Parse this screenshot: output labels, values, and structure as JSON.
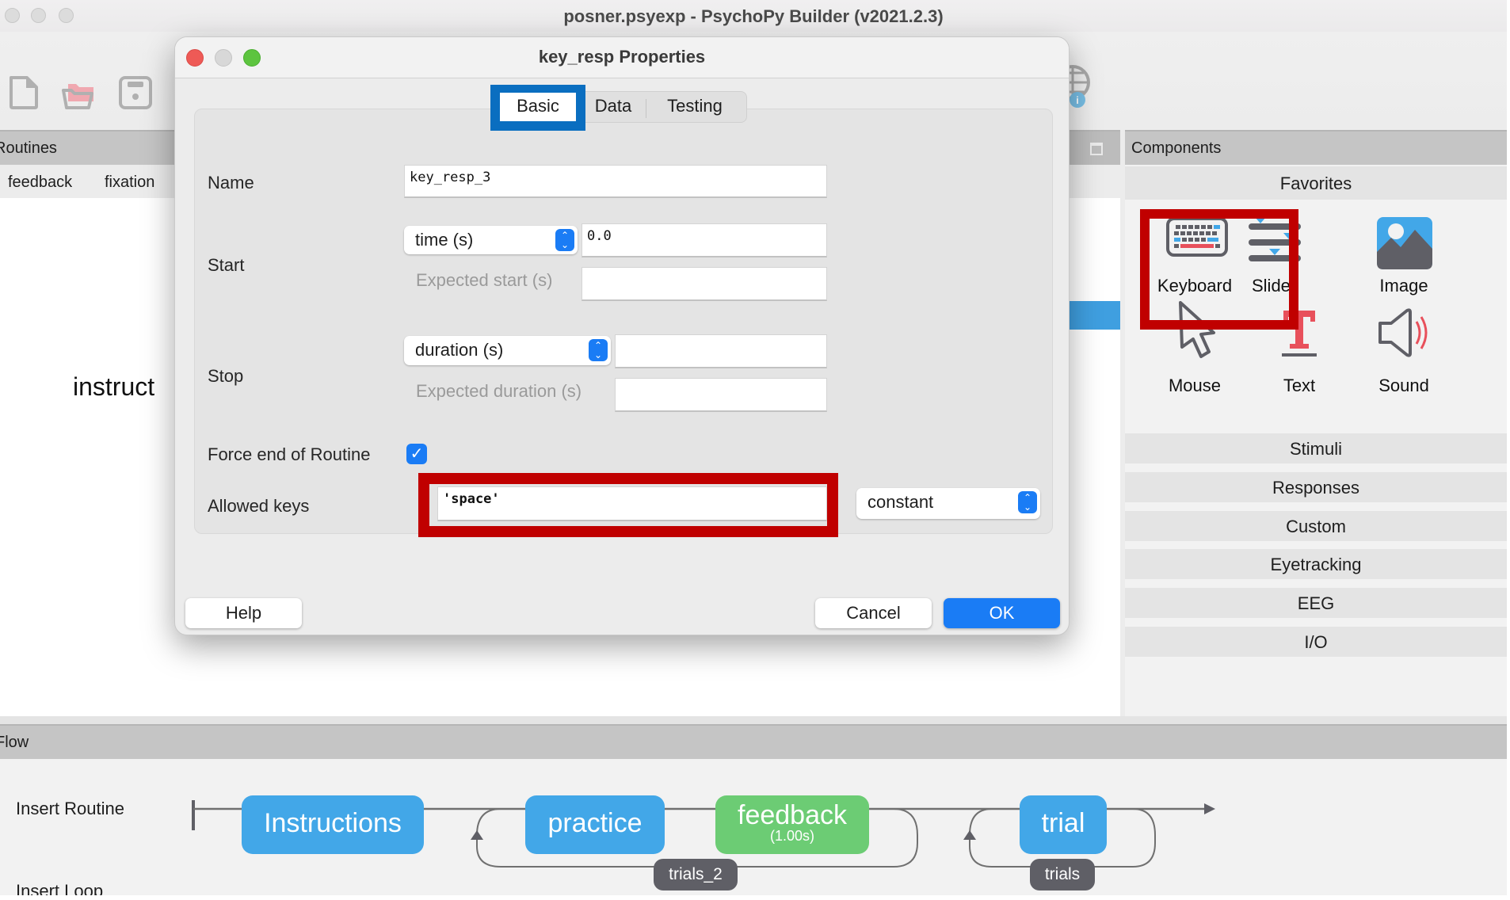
{
  "window": {
    "title": "posner.psyexp - PsychoPy Builder (v2021.2.3)"
  },
  "toolbar": {
    "icons": [
      "new-file-icon",
      "open-folder-icon",
      "save-icon",
      "pavlovia-globe-icon"
    ]
  },
  "routines": {
    "header": "Routines",
    "tabs": [
      "feedback",
      "fixation"
    ],
    "canvas_label": "instruct"
  },
  "dialog": {
    "title": "key_resp Properties",
    "tabs": [
      {
        "label": "Basic",
        "active": true
      },
      {
        "label": "Data",
        "active": false
      },
      {
        "label": "Testing",
        "active": false
      }
    ],
    "fields": {
      "name": {
        "label": "Name",
        "value": "key_resp_3"
      },
      "start": {
        "label": "Start",
        "type": "time (s)",
        "value": "0.0",
        "expected_label": "Expected start (s)",
        "expected_value": ""
      },
      "stop": {
        "label": "Stop",
        "type": "duration (s)",
        "value": "",
        "expected_label": "Expected duration (s)",
        "expected_value": ""
      },
      "force_end": {
        "label": "Force end of Routine",
        "checked": true
      },
      "allowed_keys": {
        "label": "Allowed keys",
        "value": "'space'",
        "update": "constant"
      }
    },
    "buttons": {
      "help": "Help",
      "cancel": "Cancel",
      "ok": "OK"
    }
  },
  "components": {
    "header": "Components",
    "favorites_title": "Favorites",
    "favorites": [
      {
        "label": "Keyboard",
        "icon": "keyboard-icon",
        "highlighted": true
      },
      {
        "label": "Slider",
        "icon": "slider-icon",
        "highlighted": false
      },
      {
        "label": "Image",
        "icon": "image-icon",
        "highlighted": false
      },
      {
        "label": "Mouse",
        "icon": "mouse-cursor-icon",
        "highlighted": false
      },
      {
        "label": "Text",
        "icon": "text-icon",
        "highlighted": false
      },
      {
        "label": "Sound",
        "icon": "sound-icon",
        "highlighted": false
      }
    ],
    "categories": [
      "Stimuli",
      "Responses",
      "Custom",
      "Eyetracking",
      "EEG",
      "I/O"
    ]
  },
  "flow": {
    "header": "Flow",
    "insert_routine": "Insert Routine",
    "insert_loop": "Insert Loop",
    "routines": [
      {
        "label": "Instructions",
        "color": "#42a7e8"
      },
      {
        "label": "practice",
        "color": "#42a7e8"
      },
      {
        "label": "feedback",
        "sublabel": "(1.00s)",
        "color": "#6ccc74"
      },
      {
        "label": "trial",
        "color": "#42a7e8"
      }
    ],
    "loops": [
      {
        "label": "trials_2"
      },
      {
        "label": "trials"
      }
    ]
  },
  "colors": {
    "accent_blue": "#1a7cf5",
    "annotation_red": "#c00000",
    "annotation_blue": "#0a6ec0",
    "routine_blue": "#42a7e8",
    "routine_green": "#6ccc74",
    "loop_gray": "#5f5f66"
  }
}
